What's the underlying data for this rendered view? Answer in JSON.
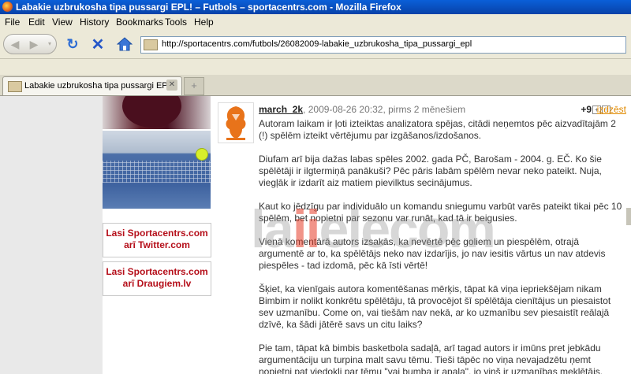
{
  "window": {
    "title": "Labakie uzbrukosha tipa pussargi EPL! – Futbols – sportacentrs.com - Mozilla Firefox"
  },
  "menu": [
    "File",
    "Edit",
    "View",
    "History",
    "Bookmarks",
    "Tools",
    "Help"
  ],
  "address": {
    "url": "http://sportacentrs.com/futbols/26082009-labakie_uzbrukosha_tipa_pussargi_epl"
  },
  "tabs": [
    {
      "label": "Labakie uzbrukosha tipa pussargi EP..."
    }
  ],
  "sidebar": {
    "links": [
      {
        "line1": "Lasi Sportacentrs.com",
        "line2": "arī Twitter.com"
      },
      {
        "line1": "Lasi Sportacentrs.com",
        "line2": "arī Draugiem.lv"
      }
    ]
  },
  "comment": {
    "author": "march_2k",
    "meta": ", 2009-08-26 20:32, pirms 2 mēnešiem",
    "score": "+9",
    "vote_plus": "+",
    "vote_minus": "-",
    "delete_label": "izdzēst",
    "paragraphs": [
      "Autoram laikam ir ļoti izteiktas analizatora spējas, citādi neņemtos pēc aizvadītajām 2 (!) spēlēm izteikt vērtējumu par izgāšanos/izdošanos.",
      "Diufam arī bija dažas labas spēles 2002. gada PČ, Barošam - 2004. g. EČ. Ko šie spēlētāji ir ilgtermiņā panākuši? Pēc pāris labām spēlēm nevar neko pateikt. Nuja, viegļāk ir izdarīt aiz matiem pievilktus secinājumus.",
      "Kaut ko jēdzīgu par individuālo un komandu sniegumu varbūt varēs pateikt tikai pēc 10 spēlēm, bet nopietni par sezonu var runāt, kad tā ir beigusies.",
      "Vienā komentārā autors izsakās, ka nevērtē pēc goliem un piespēlēm, otrajā argumentē ar to, ka spēlētājs neko nav izdarījis, jo nav iesitis vārtus un nav atdevis piespēles - tad izdomā, pēc kā īsti vērtē!",
      "Šķiet, ka vienīgais autora komentēšanas mērķis, tāpat kā viņa iepriekšējam nikam Bimbim ir nolikt konkrētu spēlētāju, tā provocējot šī spēlētāja cienītājus un piesaistot sev uzmanību. Come on, vai tiešām nav nekā, ar ko uzmanību sev piesaistīt reālajā dzīvē, ka šādi jātērē savs un citu laiks?",
      "Pie tam, tāpat kā bimbis basketbola sadaļā, arī tagad autors ir imūns pret jebkādu argumentāciju un turpina malt savu tēmu. Tieši tāpēc no viņa nevajadzētu ņemt nopietni pat viedokli par tēmu \"vai bumba ir apaļa\", jo viņš ir uzmanības meklētājs."
    ]
  },
  "watermark": {
    "pre": "la",
    "accent": "ii",
    "post": "elecom"
  },
  "colors": {
    "title_bar": "#0842a8",
    "sidebar_link": "#b50f1a",
    "delete_link": "#e08a00"
  }
}
